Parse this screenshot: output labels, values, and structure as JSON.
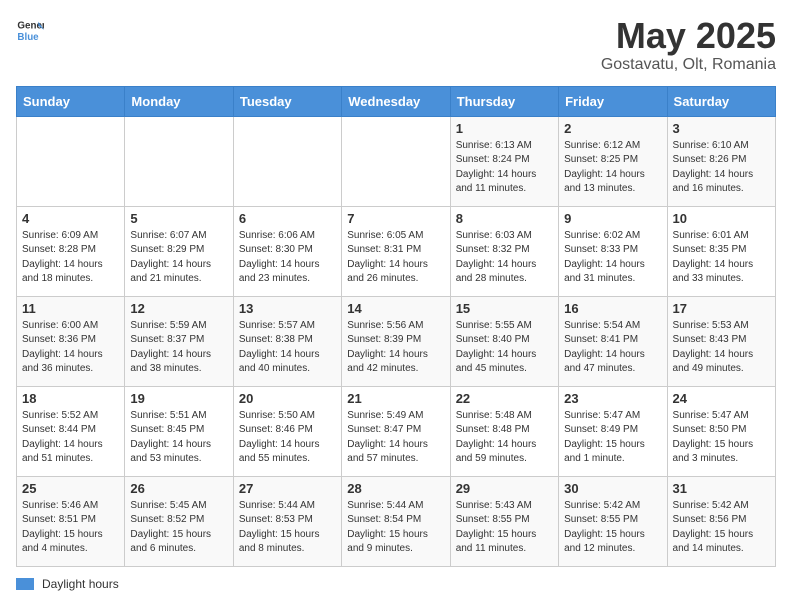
{
  "header": {
    "logo_general": "General",
    "logo_blue": "Blue",
    "title": "May 2025",
    "subtitle": "Gostavatu, Olt, Romania"
  },
  "calendar": {
    "days_of_week": [
      "Sunday",
      "Monday",
      "Tuesday",
      "Wednesday",
      "Thursday",
      "Friday",
      "Saturday"
    ],
    "weeks": [
      [
        {
          "day": "",
          "info": ""
        },
        {
          "day": "",
          "info": ""
        },
        {
          "day": "",
          "info": ""
        },
        {
          "day": "",
          "info": ""
        },
        {
          "day": "1",
          "info": "Sunrise: 6:13 AM\nSunset: 8:24 PM\nDaylight: 14 hours\nand 11 minutes."
        },
        {
          "day": "2",
          "info": "Sunrise: 6:12 AM\nSunset: 8:25 PM\nDaylight: 14 hours\nand 13 minutes."
        },
        {
          "day": "3",
          "info": "Sunrise: 6:10 AM\nSunset: 8:26 PM\nDaylight: 14 hours\nand 16 minutes."
        }
      ],
      [
        {
          "day": "4",
          "info": "Sunrise: 6:09 AM\nSunset: 8:28 PM\nDaylight: 14 hours\nand 18 minutes."
        },
        {
          "day": "5",
          "info": "Sunrise: 6:07 AM\nSunset: 8:29 PM\nDaylight: 14 hours\nand 21 minutes."
        },
        {
          "day": "6",
          "info": "Sunrise: 6:06 AM\nSunset: 8:30 PM\nDaylight: 14 hours\nand 23 minutes."
        },
        {
          "day": "7",
          "info": "Sunrise: 6:05 AM\nSunset: 8:31 PM\nDaylight: 14 hours\nand 26 minutes."
        },
        {
          "day": "8",
          "info": "Sunrise: 6:03 AM\nSunset: 8:32 PM\nDaylight: 14 hours\nand 28 minutes."
        },
        {
          "day": "9",
          "info": "Sunrise: 6:02 AM\nSunset: 8:33 PM\nDaylight: 14 hours\nand 31 minutes."
        },
        {
          "day": "10",
          "info": "Sunrise: 6:01 AM\nSunset: 8:35 PM\nDaylight: 14 hours\nand 33 minutes."
        }
      ],
      [
        {
          "day": "11",
          "info": "Sunrise: 6:00 AM\nSunset: 8:36 PM\nDaylight: 14 hours\nand 36 minutes."
        },
        {
          "day": "12",
          "info": "Sunrise: 5:59 AM\nSunset: 8:37 PM\nDaylight: 14 hours\nand 38 minutes."
        },
        {
          "day": "13",
          "info": "Sunrise: 5:57 AM\nSunset: 8:38 PM\nDaylight: 14 hours\nand 40 minutes."
        },
        {
          "day": "14",
          "info": "Sunrise: 5:56 AM\nSunset: 8:39 PM\nDaylight: 14 hours\nand 42 minutes."
        },
        {
          "day": "15",
          "info": "Sunrise: 5:55 AM\nSunset: 8:40 PM\nDaylight: 14 hours\nand 45 minutes."
        },
        {
          "day": "16",
          "info": "Sunrise: 5:54 AM\nSunset: 8:41 PM\nDaylight: 14 hours\nand 47 minutes."
        },
        {
          "day": "17",
          "info": "Sunrise: 5:53 AM\nSunset: 8:43 PM\nDaylight: 14 hours\nand 49 minutes."
        }
      ],
      [
        {
          "day": "18",
          "info": "Sunrise: 5:52 AM\nSunset: 8:44 PM\nDaylight: 14 hours\nand 51 minutes."
        },
        {
          "day": "19",
          "info": "Sunrise: 5:51 AM\nSunset: 8:45 PM\nDaylight: 14 hours\nand 53 minutes."
        },
        {
          "day": "20",
          "info": "Sunrise: 5:50 AM\nSunset: 8:46 PM\nDaylight: 14 hours\nand 55 minutes."
        },
        {
          "day": "21",
          "info": "Sunrise: 5:49 AM\nSunset: 8:47 PM\nDaylight: 14 hours\nand 57 minutes."
        },
        {
          "day": "22",
          "info": "Sunrise: 5:48 AM\nSunset: 8:48 PM\nDaylight: 14 hours\nand 59 minutes."
        },
        {
          "day": "23",
          "info": "Sunrise: 5:47 AM\nSunset: 8:49 PM\nDaylight: 15 hours\nand 1 minute."
        },
        {
          "day": "24",
          "info": "Sunrise: 5:47 AM\nSunset: 8:50 PM\nDaylight: 15 hours\nand 3 minutes."
        }
      ],
      [
        {
          "day": "25",
          "info": "Sunrise: 5:46 AM\nSunset: 8:51 PM\nDaylight: 15 hours\nand 4 minutes."
        },
        {
          "day": "26",
          "info": "Sunrise: 5:45 AM\nSunset: 8:52 PM\nDaylight: 15 hours\nand 6 minutes."
        },
        {
          "day": "27",
          "info": "Sunrise: 5:44 AM\nSunset: 8:53 PM\nDaylight: 15 hours\nand 8 minutes."
        },
        {
          "day": "28",
          "info": "Sunrise: 5:44 AM\nSunset: 8:54 PM\nDaylight: 15 hours\nand 9 minutes."
        },
        {
          "day": "29",
          "info": "Sunrise: 5:43 AM\nSunset: 8:55 PM\nDaylight: 15 hours\nand 11 minutes."
        },
        {
          "day": "30",
          "info": "Sunrise: 5:42 AM\nSunset: 8:55 PM\nDaylight: 15 hours\nand 12 minutes."
        },
        {
          "day": "31",
          "info": "Sunrise: 5:42 AM\nSunset: 8:56 PM\nDaylight: 15 hours\nand 14 minutes."
        }
      ]
    ]
  },
  "legend": {
    "label": "Daylight hours"
  }
}
